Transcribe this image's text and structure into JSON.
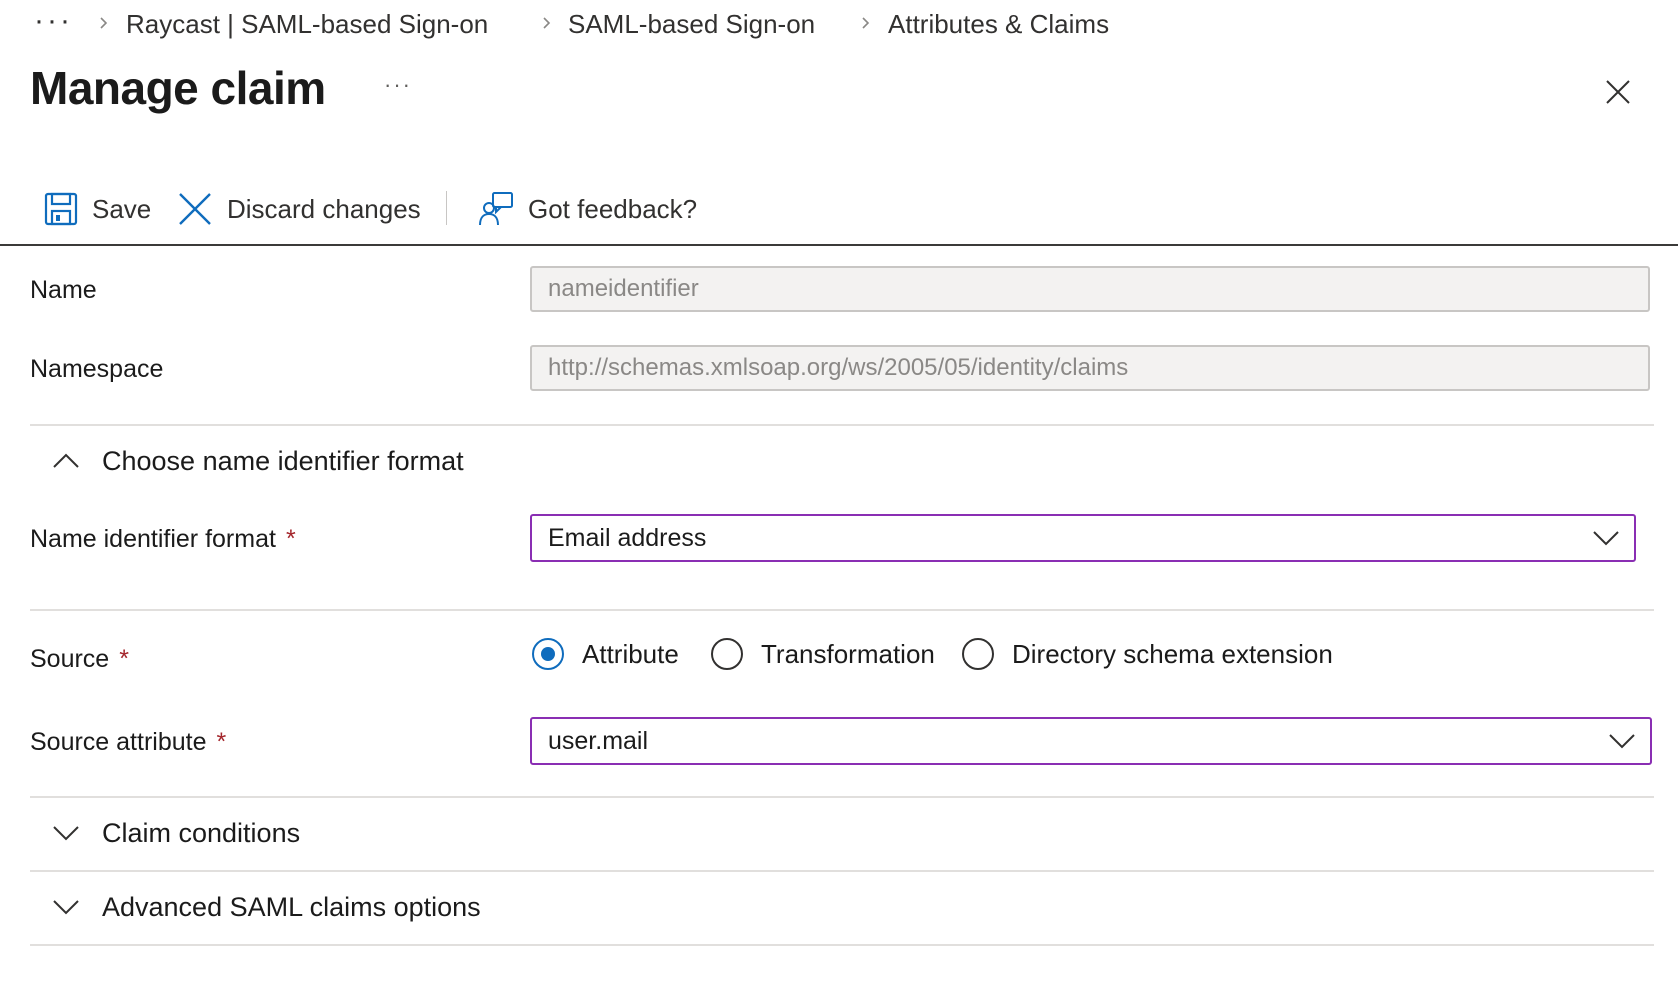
{
  "breadcrumb": {
    "overflow": "···",
    "items": [
      "Raycast | SAML-based Sign-on",
      "SAML-based Sign-on",
      "Attributes & Claims"
    ]
  },
  "header": {
    "title": "Manage claim",
    "more": "···"
  },
  "toolbar": {
    "save_label": "Save",
    "discard_label": "Discard changes",
    "feedback_label": "Got feedback?"
  },
  "form": {
    "name": {
      "label": "Name",
      "value": "nameidentifier"
    },
    "namespace": {
      "label": "Namespace",
      "value": "http://schemas.xmlsoap.org/ws/2005/05/identity/claims"
    },
    "name_id_section": {
      "title": "Choose name identifier format",
      "expanded": true
    },
    "name_id_format": {
      "label": "Name identifier format",
      "required_mark": "*",
      "selected": "Email address"
    },
    "source": {
      "label": "Source",
      "required_mark": "*",
      "options": [
        "Attribute",
        "Transformation",
        "Directory schema extension"
      ],
      "selected": "Attribute"
    },
    "source_attribute": {
      "label": "Source attribute",
      "required_mark": "*",
      "selected": "user.mail"
    },
    "claim_conditions": {
      "title": "Claim conditions",
      "expanded": false
    },
    "advanced_options": {
      "title": "Advanced SAML claims options",
      "expanded": false
    }
  },
  "colors": {
    "accent_blue": "#0f6cbd",
    "select_border": "#8a2eb3",
    "required": "#a4262c"
  },
  "icons": {
    "save": "save-icon",
    "discard": "close-icon",
    "feedback": "feedback-icon",
    "close": "close-icon",
    "chevron_up": "chevron-up-icon",
    "chevron_down": "chevron-down-icon"
  }
}
